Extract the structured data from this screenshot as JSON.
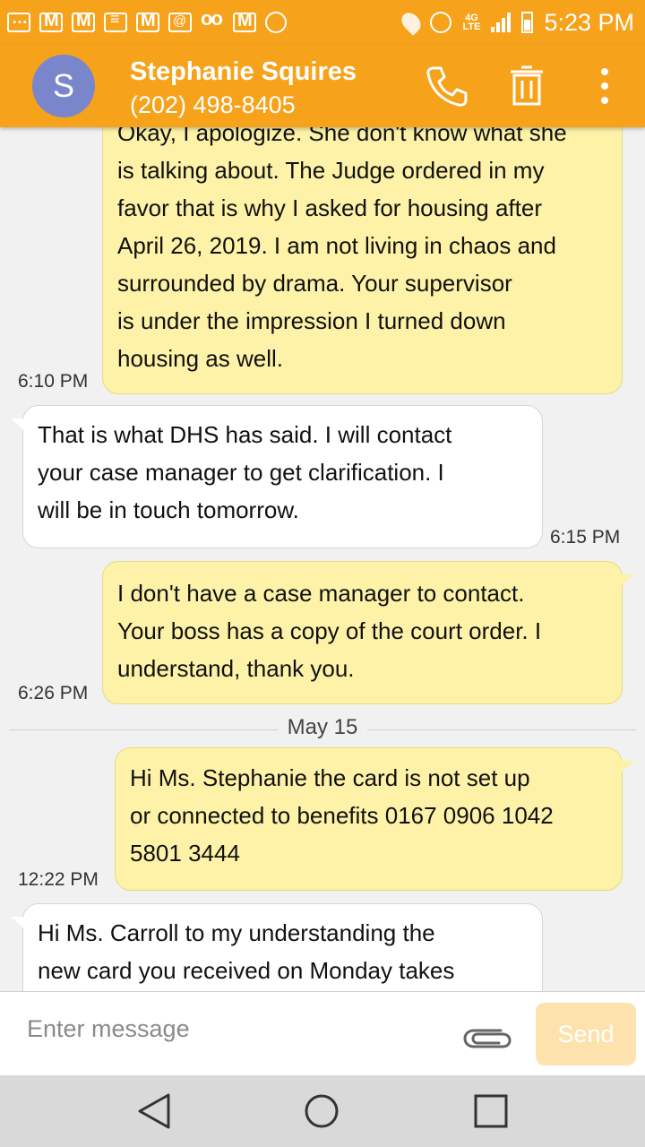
{
  "status_bar": {
    "time": "5:23 PM",
    "network": "4G",
    "network_sub": "LTE",
    "notification_icons": [
      "more-notifications-icon",
      "gmail-icon",
      "gmail-icon",
      "message-icon",
      "gmail-icon",
      "email-at-icon",
      "voicemail-icon",
      "gmail-icon",
      "alarm-icon"
    ]
  },
  "header": {
    "avatar_letter": "S",
    "contact_name": "Stephanie Squires",
    "contact_phone": "(202) 498-8405"
  },
  "messages": [
    {
      "direction": "out",
      "text": "Okay, I apologize. She don't know what she\nis talking about. The Judge ordered in my\nfavor that is why I asked for housing after\nApril 26, 2019. I am not living in chaos and\nsurrounded by drama. Your supervisor\nis under the impression I turned down\nhousing as well.",
      "time": "6:10 PM"
    },
    {
      "direction": "in",
      "text": "That is what DHS has said. I will contact\nyour case manager to get clarification. I\nwill be in touch tomorrow.",
      "time": "6:15 PM"
    },
    {
      "direction": "out",
      "text": "I don't have a case manager to contact.\nYour boss has a copy of the court order. I\nunderstand, thank you.",
      "time": "6:26 PM"
    },
    {
      "direction": "out",
      "text": "Hi Ms. Stephanie the card is not set up\nor connected to benefits 0167 0906 1042\n5801 3444",
      "time": "12:22 PM"
    },
    {
      "direction": "in",
      "text": "Hi Ms. Carroll to my understanding the\nnew card you received on Monday takes",
      "time": ""
    }
  ],
  "date_separator": "May 15",
  "composer": {
    "placeholder": "Enter message",
    "send_label": "Send"
  },
  "colors": {
    "accent": "#f7a21b",
    "outgoing_bubble": "#fdf2a7",
    "incoming_bubble": "#ffffff",
    "send_disabled": "#fde2ad"
  }
}
